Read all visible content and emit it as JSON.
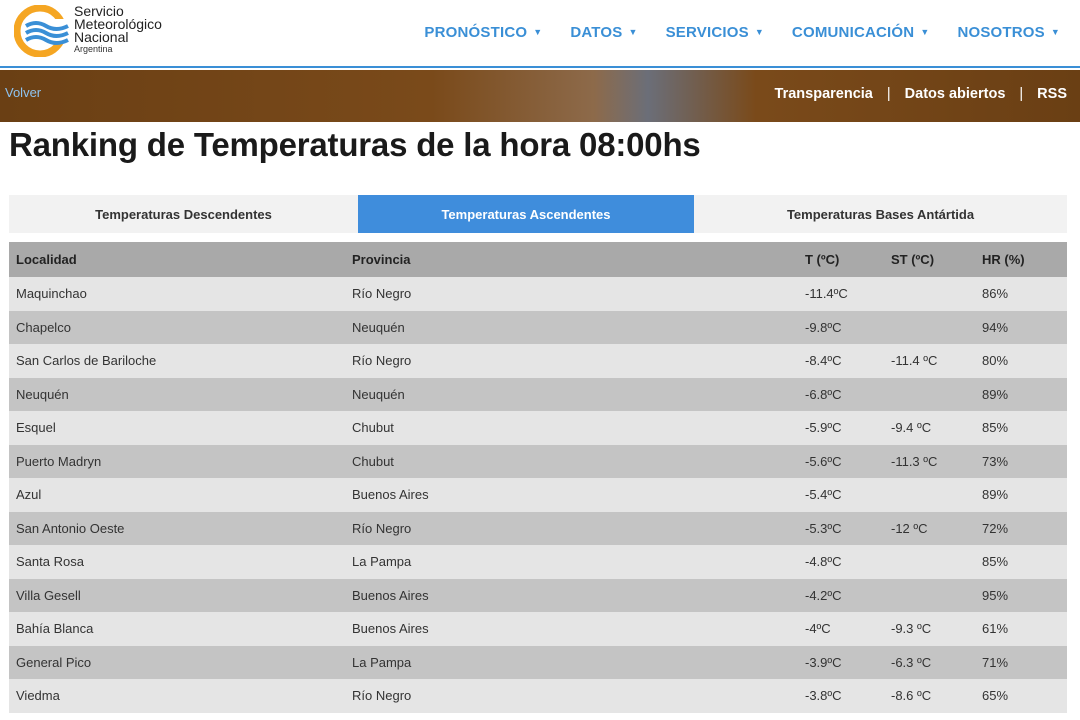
{
  "header": {
    "logo": {
      "line1": "Servicio",
      "line2": "Meteorológico",
      "line3": "Nacional",
      "line4": "Argentina"
    },
    "nav": [
      {
        "label": "PRONÓSTICO"
      },
      {
        "label": "DATOS"
      },
      {
        "label": "SERVICIOS"
      },
      {
        "label": "COMUNICACIÓN"
      },
      {
        "label": "NOSOTROS"
      }
    ]
  },
  "subbar": {
    "back_label": "Volver",
    "links": [
      "Transparencia",
      "Datos abiertos",
      "RSS"
    ]
  },
  "page_title": "Ranking de Temperaturas de la hora 08:00hs",
  "tabs": [
    {
      "label": "Temperaturas Descendentes",
      "active": false
    },
    {
      "label": "Temperaturas Ascendentes",
      "active": true
    },
    {
      "label": "Temperaturas Bases Antártida",
      "active": false
    }
  ],
  "table": {
    "headers": [
      "Localidad",
      "Provincia",
      "T (ºC)",
      "ST (ºC)",
      "HR (%)"
    ],
    "rows": [
      [
        "Maquinchao",
        "Río Negro",
        "-11.4ºC",
        "",
        "86%"
      ],
      [
        "Chapelco",
        "Neuquén",
        "-9.8ºC",
        "",
        "94%"
      ],
      [
        "San Carlos de Bariloche",
        "Río Negro",
        "-8.4ºC",
        "-11.4 ºC",
        "80%"
      ],
      [
        "Neuquén",
        "Neuquén",
        "-6.8ºC",
        "",
        "89%"
      ],
      [
        "Esquel",
        "Chubut",
        "-5.9ºC",
        "-9.4 ºC",
        "85%"
      ],
      [
        "Puerto Madryn",
        "Chubut",
        "-5.6ºC",
        "-11.3 ºC",
        "73%"
      ],
      [
        "Azul",
        "Buenos Aires",
        "-5.4ºC",
        "",
        "89%"
      ],
      [
        "San Antonio Oeste",
        "Río Negro",
        "-5.3ºC",
        "-12 ºC",
        "72%"
      ],
      [
        "Santa Rosa",
        "La Pampa",
        "-4.8ºC",
        "",
        "85%"
      ],
      [
        "Villa Gesell",
        "Buenos Aires",
        "-4.2ºC",
        "",
        "95%"
      ],
      [
        "Bahía Blanca",
        "Buenos Aires",
        "-4ºC",
        "-9.3 ºC",
        "61%"
      ],
      [
        "General Pico",
        "La Pampa",
        "-3.9ºC",
        "-6.3 ºC",
        "71%"
      ],
      [
        "Viedma",
        "Río Negro",
        "-3.8ºC",
        "-8.6 ºC",
        "65%"
      ]
    ]
  },
  "colors": {
    "accent": "#3a8fd6",
    "logo_orange": "#f5a623",
    "active_tab": "#3f8ddc",
    "header_row": "#a9a9a9",
    "row_light": "#e5e5e5",
    "row_dark": "#c4c4c4"
  }
}
